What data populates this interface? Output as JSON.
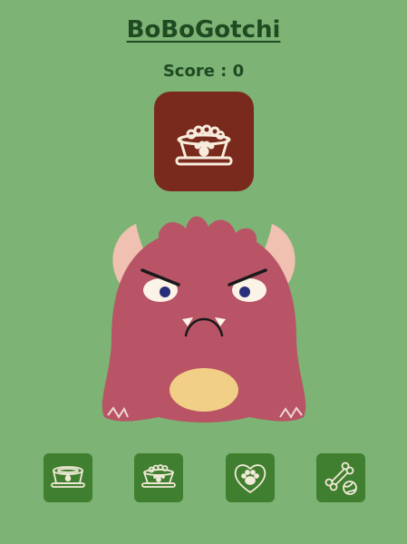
{
  "app": {
    "title": "BoBoGotchi",
    "score_text": "Score : 0"
  },
  "current_action": {
    "icon": "food-bowl-icon"
  },
  "monster": {
    "mood": "angry"
  },
  "actions": [
    {
      "id": "water",
      "icon": "water-bowl-icon"
    },
    {
      "id": "feed",
      "icon": "food-bowl-icon"
    },
    {
      "id": "pet",
      "icon": "paw-heart-icon"
    },
    {
      "id": "play",
      "icon": "bone-ball-icon"
    }
  ],
  "colors": {
    "background": "#7db374",
    "title": "#1f4a22",
    "card": "#7a2a1c",
    "button": "#3f7f2f",
    "monster_body": "#b85466",
    "monster_horn": "#f0c0b0",
    "monster_belly": "#f2cf86"
  }
}
